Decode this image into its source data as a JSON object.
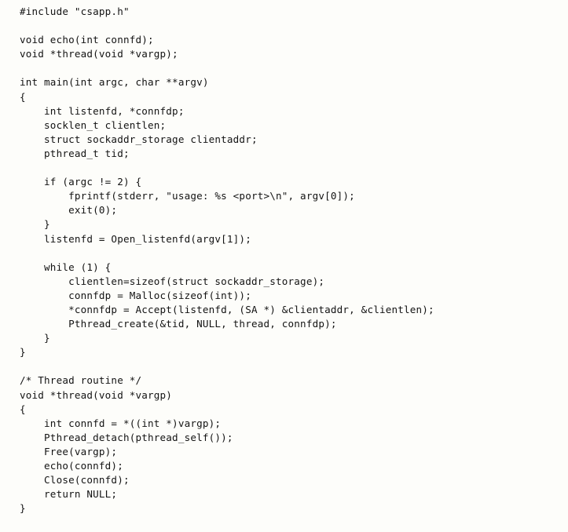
{
  "document": {
    "kind": "code-listing",
    "language": "c",
    "background_color": "#fdfdfa",
    "text_color": "#131313"
  },
  "code": {
    "lines": [
      "#include \"csapp.h\"",
      "",
      "void echo(int connfd);",
      "void *thread(void *vargp);",
      "",
      "int main(int argc, char **argv)",
      "{",
      "    int listenfd, *connfdp;",
      "    socklen_t clientlen;",
      "    struct sockaddr_storage clientaddr;",
      "    pthread_t tid;",
      "",
      "    if (argc != 2) {",
      "        fprintf(stderr, \"usage: %s <port>\\n\", argv[0]);",
      "        exit(0);",
      "    }",
      "    listenfd = Open_listenfd(argv[1]);",
      "",
      "    while (1) {",
      "        clientlen=sizeof(struct sockaddr_storage);",
      "        connfdp = Malloc(sizeof(int));",
      "        *connfdp = Accept(listenfd, (SA *) &clientaddr, &clientlen);",
      "        Pthread_create(&tid, NULL, thread, connfdp);",
      "    }",
      "}",
      "",
      "/* Thread routine */",
      "void *thread(void *vargp)",
      "{",
      "    int connfd = *((int *)vargp);",
      "    Pthread_detach(pthread_self());",
      "    Free(vargp);",
      "    echo(connfd);",
      "    Close(connfd);",
      "    return NULL;",
      "}"
    ]
  }
}
